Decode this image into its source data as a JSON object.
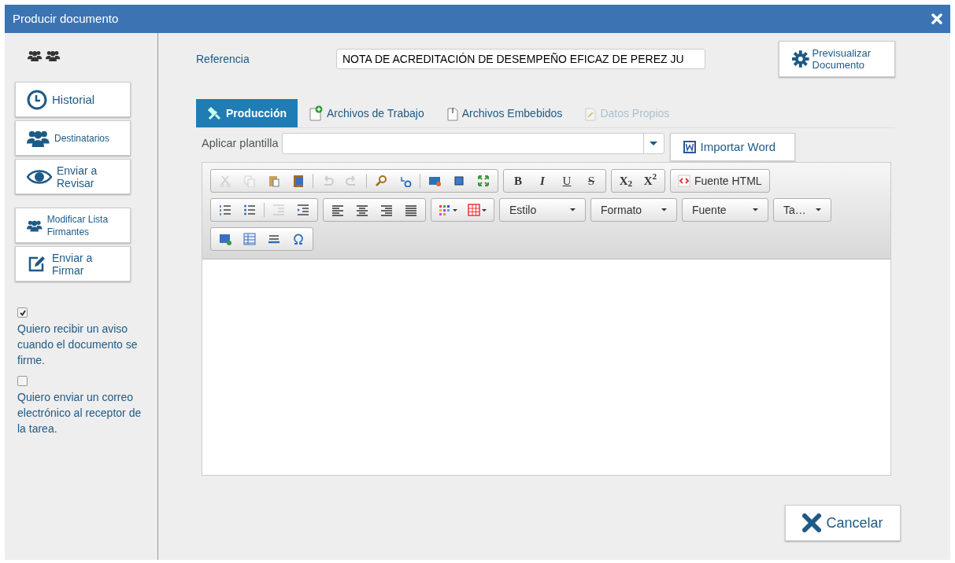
{
  "window": {
    "title": "Producir documento"
  },
  "sidebar": {
    "buttons": [
      {
        "kind": "clock",
        "label": "Historial"
      },
      {
        "kind": "people",
        "label": "Destinatarios"
      },
      {
        "kind": "eye",
        "label": "Enviar a Revisar"
      },
      {
        "kind": "people",
        "label": "Modificar Lista Firmantes"
      },
      {
        "kind": "edit",
        "label": "Enviar a Firmar"
      }
    ],
    "checkboxes": [
      {
        "label": "Quiero recibir un aviso cuando el documento se firme.",
        "checked": true
      },
      {
        "label": "Quiero enviar un correo electrónico al receptor de la tarea.",
        "checked": false
      }
    ]
  },
  "reference": {
    "label": "Referencia",
    "value": "NOTA DE ACREDITACIÓN DE DESEMPEÑO EFICAZ DE PEREZ JU"
  },
  "preview_button": {
    "label": "Previsualizar Documento"
  },
  "tabs": [
    {
      "kind": "tools",
      "label": "Producción",
      "selected": true,
      "disabled": false
    },
    {
      "kind": "file-plus",
      "label": "Archivos de Trabajo",
      "selected": false,
      "disabled": false
    },
    {
      "kind": "clip",
      "label": "Archivos Embebidos",
      "selected": false,
      "disabled": false
    },
    {
      "kind": "doc",
      "label": "Datos Propios",
      "selected": false,
      "disabled": true
    }
  ],
  "template": {
    "label": "Aplicar plantilla"
  },
  "import_button": {
    "label": "Importar Word"
  },
  "toolbar": {
    "rows": [
      [
        [
          {
            "kind": "cut",
            "disabled": true
          },
          {
            "kind": "copy",
            "disabled": true
          },
          {
            "kind": "paste",
            "disabled": false
          },
          {
            "kind": "paste-word",
            "disabled": false
          },
          {
            "kind": "sep"
          },
          {
            "kind": "undo",
            "disabled": true
          },
          {
            "kind": "redo",
            "disabled": true
          },
          {
            "kind": "sep"
          },
          {
            "kind": "find",
            "disabled": false
          },
          {
            "kind": "replace",
            "disabled": false
          },
          {
            "kind": "sep"
          },
          {
            "kind": "html",
            "disabled": false
          },
          {
            "kind": "select-all",
            "disabled": false
          },
          {
            "kind": "maximize",
            "disabled": false
          }
        ],
        [
          {
            "kind": "bold",
            "label": "B"
          },
          {
            "kind": "italic",
            "label": "I"
          },
          {
            "kind": "underline",
            "label": "U"
          },
          {
            "kind": "strike",
            "label": "S"
          }
        ],
        [
          {
            "kind": "bold",
            "label": "X$_{2}$"
          },
          {
            "kind": "bold",
            "label": "X$^{2}$"
          }
        ],
        [
          {
            "kind": "source",
            "label": "Fuente HTML"
          }
        ]
      ],
      [
        [
          {
            "kind": "ol",
            "disabled": false
          },
          {
            "kind": "ul",
            "disabled": false
          },
          {
            "kind": "sep"
          },
          {
            "kind": "outdent",
            "disabled": true
          },
          {
            "kind": "indent",
            "disabled": false
          }
        ],
        [
          {
            "kind": "left",
            "disabled": false
          },
          {
            "kind": "center",
            "disabled": false
          },
          {
            "kind": "right",
            "disabled": false
          },
          {
            "kind": "justify",
            "disabled": false
          }
        ],
        [
          {
            "kind": "colors",
            "disabled": false
          },
          {
            "kind": "table",
            "disabled": false
          }
        ]
      ],
      [
        [
          {
            "kind": "image",
            "disabled": false
          },
          {
            "kind": "table2",
            "disabled": false
          },
          {
            "kind": "hr",
            "disabled": false
          },
          {
            "kind": "omega",
            "disabled": false
          }
        ]
      ]
    ],
    "dropdowns": [
      "Estilo",
      "Formato",
      "Fuente",
      "Ta…"
    ]
  },
  "cancel_button": {
    "label": "Cancelar"
  }
}
